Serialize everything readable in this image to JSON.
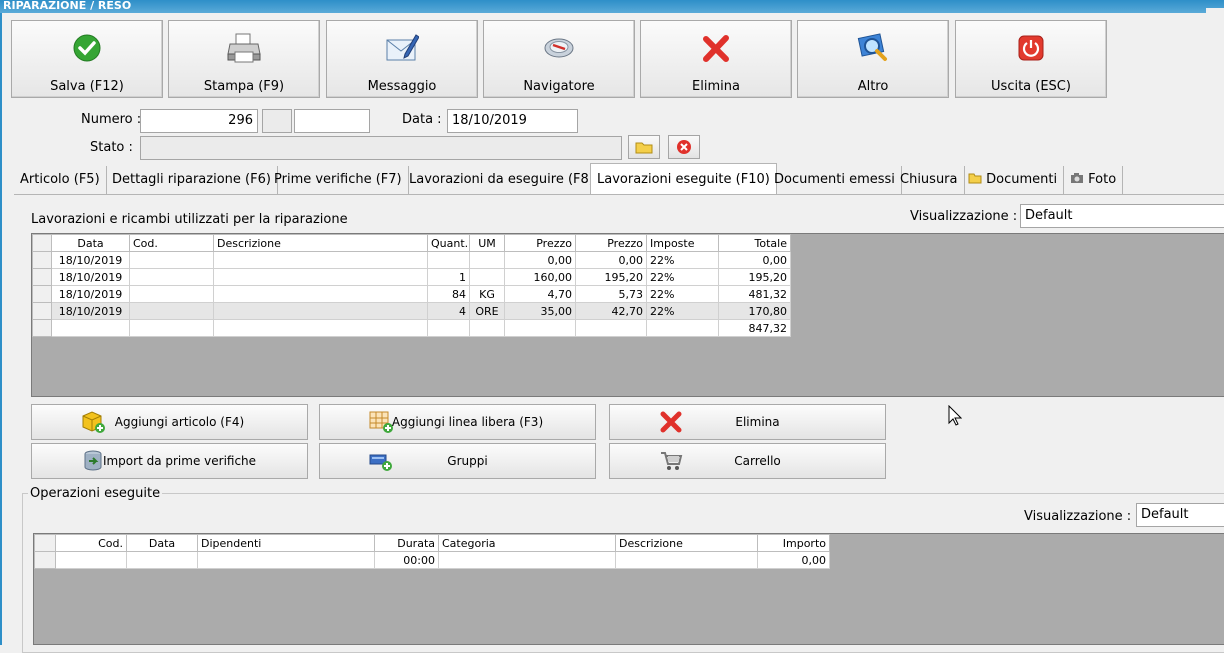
{
  "window": {
    "title": "RIPARAZIONE / RESO"
  },
  "toolbar": [
    {
      "label": "Salva (F12)",
      "icon": "check-icon"
    },
    {
      "label": "Stampa (F9)",
      "icon": "printer-icon"
    },
    {
      "label": "Messaggio",
      "icon": "envelope-pen-icon"
    },
    {
      "label": "Navigatore",
      "icon": "compass-icon"
    },
    {
      "label": "Elimina",
      "icon": "red-x-icon"
    },
    {
      "label": "Altro",
      "icon": "magnifier-icon"
    },
    {
      "label": "Uscita (ESC)",
      "icon": "power-icon"
    }
  ],
  "form": {
    "numero_label": "Numero :",
    "numero_value": "296",
    "data_label": "Data :",
    "data_value": "18/10/2019",
    "stato_label": "Stato :",
    "stato_value": ""
  },
  "tabs": [
    "Articolo (F5)",
    "Dettagli riparazione (F6)",
    "Prime verifiche (F7)",
    "Lavorazioni da eseguire (F8)",
    "Lavorazioni eseguite  (F10)",
    "Documenti emessi",
    "Chiusura",
    "Documenti",
    "Foto"
  ],
  "active_tab": "Lavorazioni eseguite  (F10)",
  "lavorazioni": {
    "title": "Lavorazioni e ricambi utilizzati per la riparazione",
    "view_label": "Visualizzazione :",
    "view_value": "Default",
    "columns": [
      "Data",
      "Cod.",
      "Descrizione",
      "Quant.",
      "UM",
      "Prezzo",
      "Prezzo",
      "Imposte",
      "Totale"
    ],
    "rows": [
      [
        "18/10/2019",
        "",
        "",
        "",
        "",
        "0,00",
        "0,00",
        "22%",
        "0,00"
      ],
      [
        "18/10/2019",
        "",
        "",
        "1",
        "",
        "160,00",
        "195,20",
        "22%",
        "195,20"
      ],
      [
        "18/10/2019",
        "",
        "",
        "84",
        "KG",
        "4,70",
        "5,73",
        "22%",
        "481,32"
      ],
      [
        "18/10/2019",
        "",
        "",
        "4",
        "ORE",
        "35,00",
        "42,70",
        "22%",
        "170,80"
      ]
    ],
    "total": "847,32"
  },
  "actions": [
    {
      "label": "Aggiungi articolo (F4)",
      "icon": "box-add-icon"
    },
    {
      "label": "Aggiungi linea libera (F3)",
      "icon": "grid-add-icon"
    },
    {
      "label": "Elimina",
      "icon": "red-x-icon"
    },
    {
      "label": "Import da prime verifiche",
      "icon": "database-import-icon"
    },
    {
      "label": "Gruppi",
      "icon": "group-add-icon"
    },
    {
      "label": "Carrello",
      "icon": "cart-icon"
    }
  ],
  "operazioni": {
    "title": "Operazioni eseguite",
    "view_label": "Visualizzazione :",
    "view_value": "Default",
    "columns": [
      "Cod.",
      "Data",
      "Dipendenti",
      "Durata",
      "Categoria",
      "Descrizione",
      "Importo"
    ],
    "rows": [
      [
        "",
        "",
        "",
        "00:00",
        "",
        "",
        "0,00"
      ]
    ]
  },
  "colors": {
    "titlebar": "#2e8fc8",
    "grid_bg": "#ababab",
    "delete_red": "#e0312b",
    "ok_green": "#35a534"
  }
}
